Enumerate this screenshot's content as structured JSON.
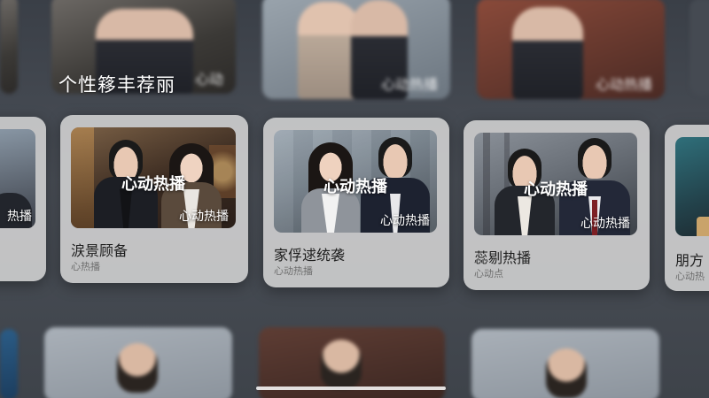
{
  "section": {
    "title": "个性簃丰荐丽"
  },
  "background_badges": [
    "心动",
    "心动热播",
    "心动热播"
  ],
  "cards": [
    {
      "banner": "",
      "tag": "热播",
      "title": "",
      "subtitle": ""
    },
    {
      "banner": "心动热播",
      "tag": "心动热播",
      "title": "涙景顾备",
      "subtitle": "心热播"
    },
    {
      "banner": "心动热播",
      "tag": "心动热播",
      "title": "家俘逑统袭",
      "subtitle": "心动热播"
    },
    {
      "banner": "心动热播",
      "tag": "心动热播",
      "title": "蕊剔热播",
      "subtitle": "心动点"
    },
    {
      "banner": "",
      "tag": "",
      "title": "朋方",
      "subtitle": "心动热"
    }
  ],
  "colors": {
    "card_bg": "#d6d6d6",
    "title_text": "#1d1d1d",
    "subtitle_text": "#6e6e6e"
  }
}
